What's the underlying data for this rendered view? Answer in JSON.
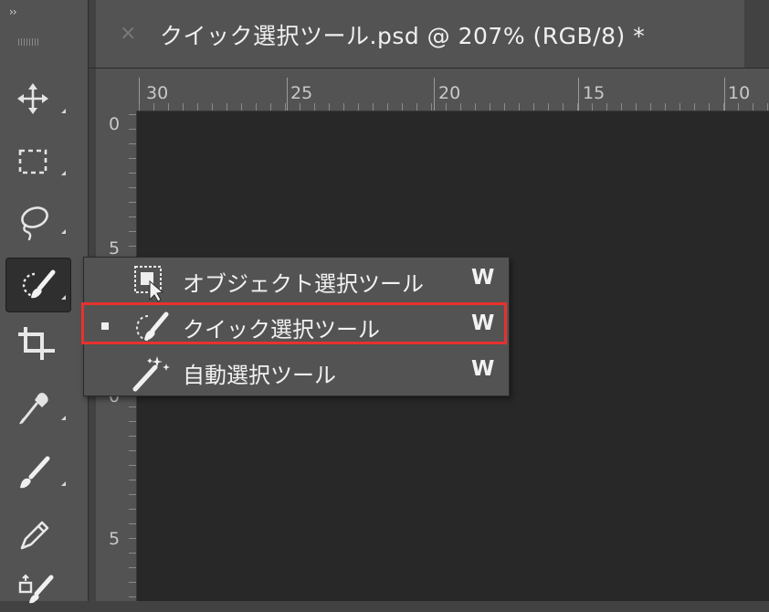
{
  "toolbar": {
    "collapse_glyph": "››",
    "tools": [
      {
        "name": "move-tool",
        "icon": "move-icon"
      },
      {
        "name": "marquee-tool",
        "icon": "rectangular-marquee-icon"
      },
      {
        "name": "lasso-tool",
        "icon": "lasso-icon"
      },
      {
        "name": "quick-selection-tool",
        "icon": "quick-selection-icon",
        "active": true
      },
      {
        "name": "crop-tool",
        "icon": "crop-icon"
      },
      {
        "name": "eyedropper-tool",
        "icon": "eyedropper-icon"
      },
      {
        "name": "brush-tool",
        "icon": "brush-icon"
      },
      {
        "name": "pencil-tool",
        "icon": "pencil-icon"
      },
      {
        "name": "history-brush-tool",
        "icon": "history-brush-icon"
      }
    ]
  },
  "document": {
    "close_glyph": "×",
    "tab_title": "クイック選択ツール.psd @ 207% (RGB/8) *"
  },
  "ruler_top": {
    "labels": [
      "30",
      "25",
      "20",
      "15",
      "10"
    ]
  },
  "ruler_left": {
    "labels": [
      "0",
      "5",
      "0",
      "5"
    ]
  },
  "flyout": {
    "items": [
      {
        "label": "オブジェクト選択ツール",
        "shortcut": "W",
        "icon": "object-selection-icon",
        "selected": false
      },
      {
        "label": "クイック選択ツール",
        "shortcut": "W",
        "icon": "quick-selection-icon",
        "selected": true
      },
      {
        "label": "自動選択ツール",
        "shortcut": "W",
        "icon": "magic-wand-icon",
        "selected": false
      }
    ]
  },
  "colors": {
    "panel": "#535353",
    "canvas": "#282828",
    "highlight": "#e8312f"
  }
}
